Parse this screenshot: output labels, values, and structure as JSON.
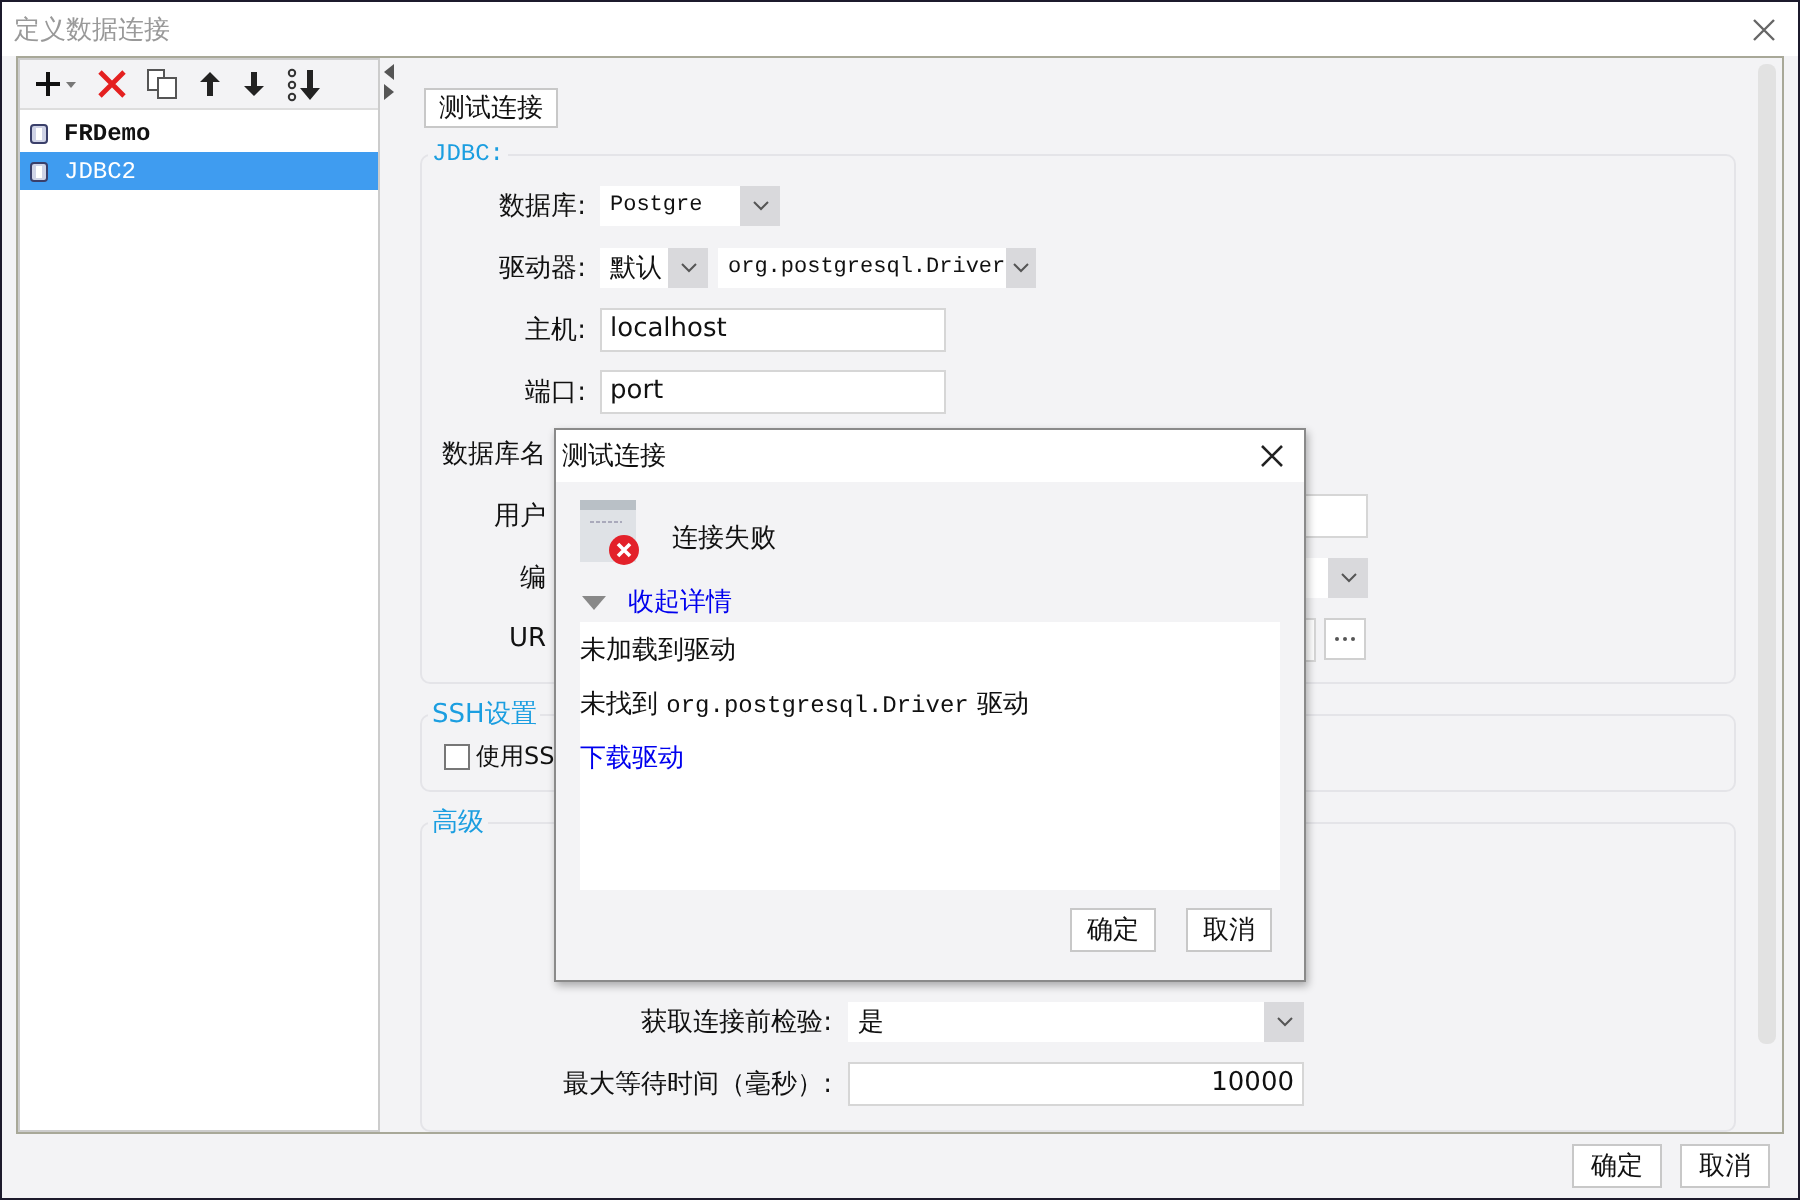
{
  "window": {
    "title": "定义数据连接",
    "buttons": [
      "确定",
      "取消"
    ]
  },
  "connections": [
    {
      "name": "FRDemo",
      "selected": false
    },
    {
      "name": "JDBC2",
      "selected": true
    }
  ],
  "test_button": "测试连接",
  "jdbc": {
    "legend": "JDBC:",
    "rows": [
      {
        "kind": "select",
        "label": "数据库:",
        "value": "Postgre"
      },
      {
        "kind": "driver",
        "label": "驱动器:",
        "values": [
          "默认",
          "org.postgresql.Driver"
        ]
      },
      {
        "kind": "input",
        "label": "主机:",
        "value": "localhost"
      },
      {
        "kind": "input",
        "label": "端口:",
        "value": "port"
      },
      {
        "kind": "covered",
        "label": "数据库名"
      },
      {
        "kind": "covered-input",
        "label": "用户"
      },
      {
        "kind": "covered-select",
        "label": "编"
      },
      {
        "kind": "covered-url",
        "label": "UR"
      }
    ]
  },
  "ssh": {
    "legend": "SSH设置",
    "use_ssh": {
      "label": "使用SS",
      "checked": false
    }
  },
  "advanced": {
    "legend": "高级",
    "rows": [
      {
        "kind": "select",
        "label": "获取连接前检验:",
        "value": "是"
      },
      {
        "kind": "input",
        "label": "最大等待时间（毫秒）:",
        "value": "10000"
      }
    ]
  },
  "dialog": {
    "title": "测试连接",
    "status": "连接失败",
    "details_toggle": "收起详情",
    "details_expanded": true,
    "details": [
      {
        "kind": "text",
        "segments": [
          {
            "kind": "plain",
            "text": "未加载到驱动"
          }
        ]
      },
      {
        "kind": "text",
        "segments": [
          {
            "kind": "plain",
            "text": "未找到 "
          },
          {
            "kind": "code",
            "text": "org.postgresql.Driver"
          },
          {
            "kind": "plain",
            "text": " 驱动"
          }
        ]
      },
      {
        "kind": "link",
        "segments": [
          {
            "kind": "plain",
            "text": "下载驱动"
          }
        ]
      }
    ],
    "buttons": [
      "确定",
      "取消"
    ]
  }
}
